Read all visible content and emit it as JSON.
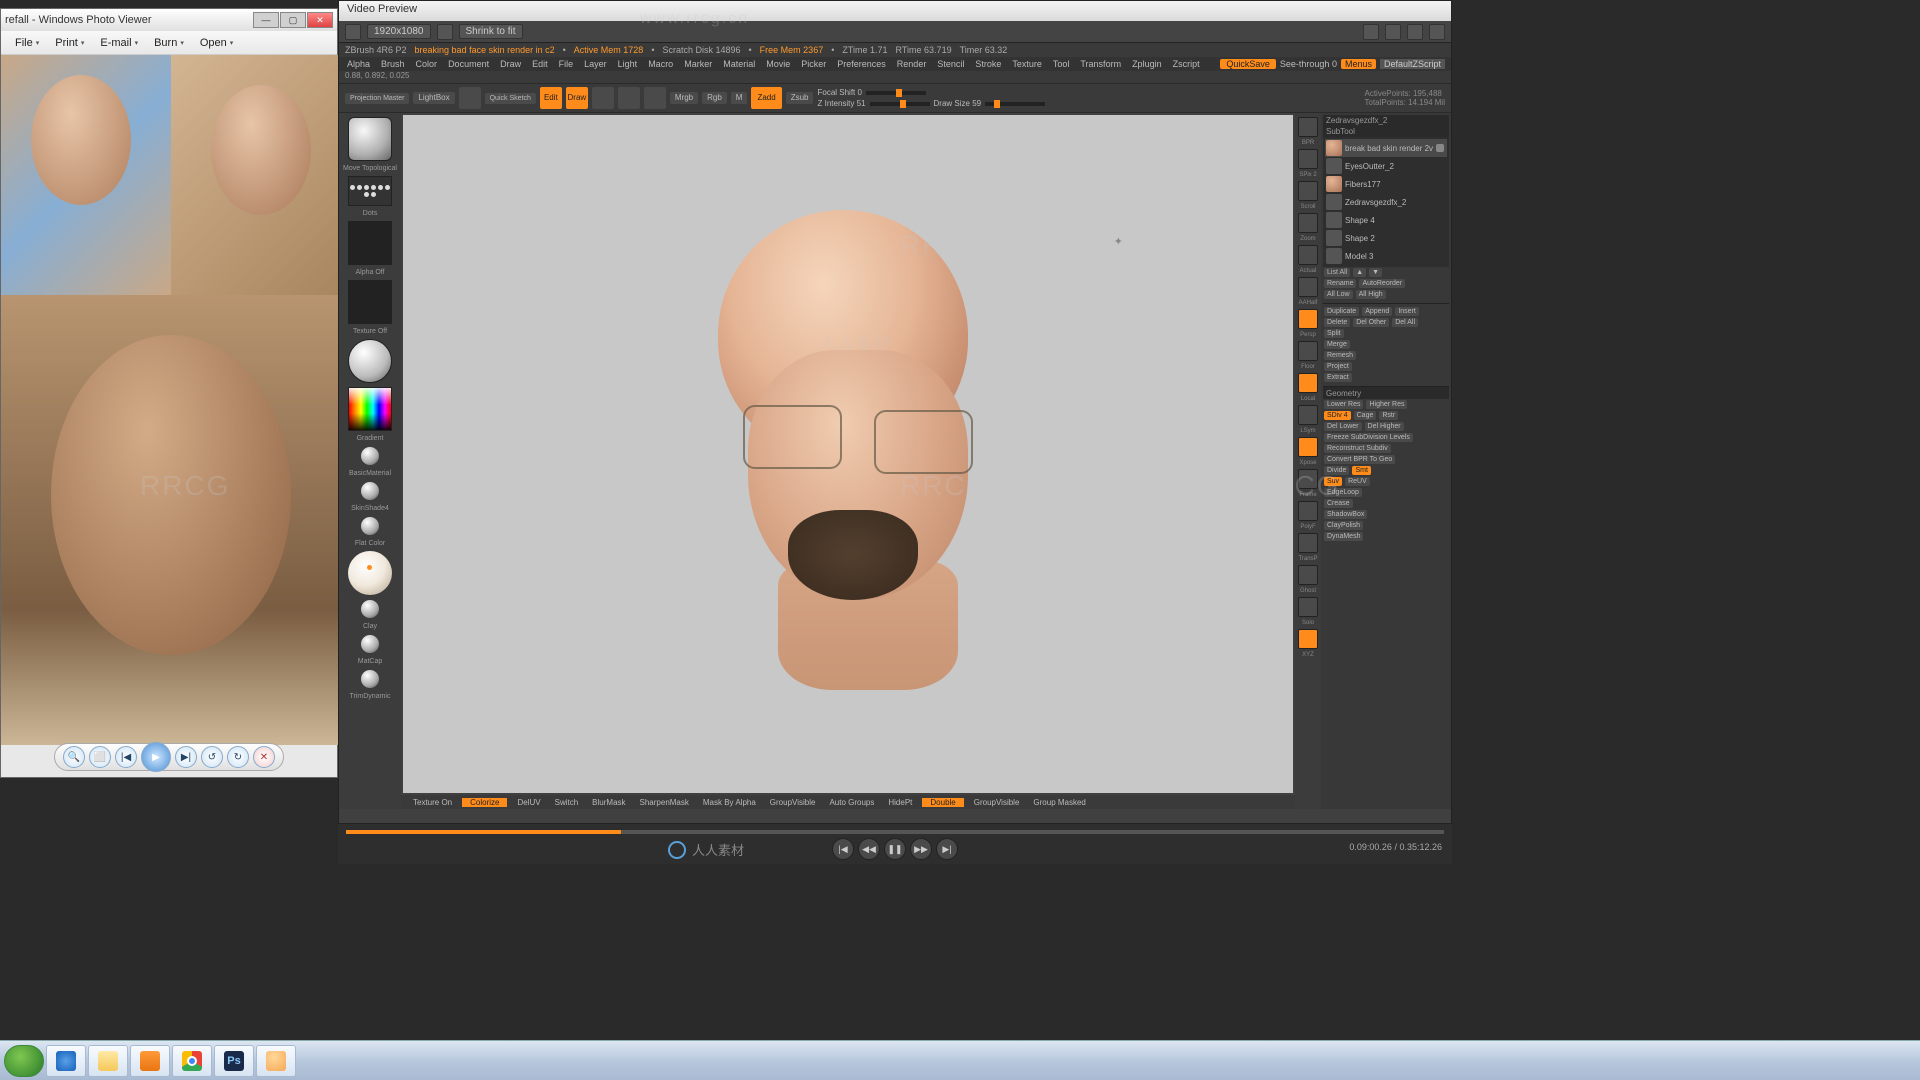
{
  "photoViewer": {
    "title": "refall - Windows Photo Viewer",
    "menu": [
      "File",
      "Print",
      "E-mail",
      "Burn",
      "Open"
    ],
    "controls": {
      "zoom": "🔍",
      "fit": "⬜",
      "prev": "|◀",
      "play": "▶",
      "next": "▶|",
      "rotL": "↺",
      "rotR": "↻",
      "del": "✕"
    }
  },
  "videoPreview": {
    "title": "Video Preview",
    "resolution": "1920x1080",
    "fit": "Shrink to fit"
  },
  "zbrush": {
    "topInfo": {
      "version": "ZBrush 4R6 P2",
      "project": "breaking bad face skin render in c2",
      "activeMem": "Active Mem 1728",
      "scratch": "Scratch Disk 14896",
      "freeMem": "Free Mem 2367",
      "ztime": "ZTime 1.71",
      "rtime": "RTime 63.719",
      "timer": "Timer 63.32"
    },
    "subInfo": "0.88, 0.892, 0.025",
    "menus": [
      "Alpha",
      "Brush",
      "Color",
      "Document",
      "Draw",
      "Edit",
      "File",
      "Layer",
      "Light",
      "Macro",
      "Marker",
      "Material",
      "Movie",
      "Picker",
      "Preferences",
      "Render",
      "Stencil",
      "Stroke",
      "Texture",
      "Tool",
      "Transform",
      "Zplugin",
      "Zscript"
    ],
    "menuRight": {
      "quickSave": "QuickSave",
      "seeThrough": "See-through 0",
      "menus": "Menus",
      "defaultScript": "DefaultZScript"
    },
    "shelf": {
      "projMaster": "Projection\nMaster",
      "lightBox": "LightBox",
      "quickSketch": "Quick\nSketch",
      "edit": "Edit",
      "draw": "Draw",
      "move": "Move",
      "scale": "Scale",
      "rotate": "Rotate",
      "mrgb": "Mrgb",
      "rgb": "Rgb",
      "m": "M",
      "zadd": "Zadd",
      "zsub": "Zsub",
      "focalShift": "Focal Shift 0",
      "zIntensity": "Z Intensity 51",
      "drawSize": "Draw Size 59",
      "activePoints": "ActivePoints: 195,488",
      "totalPoints": "TotalPoints: 14.194 Mil"
    },
    "leftBar": {
      "brush": "Move Topological",
      "stroke": "Dots",
      "alpha": "Alpha Off",
      "texture": "Texture Off",
      "gradient": "Gradient",
      "materials": [
        "BasicMaterial",
        "SkinShade4",
        "Flat Color",
        "Clay",
        "MatCap",
        "TrimDynamic"
      ]
    },
    "rightTools": [
      "BPR",
      "SPix 2",
      "Scroll",
      "Zoom",
      "Actual",
      "AAHalf",
      "Persp",
      "Floor",
      "Local",
      "LSym",
      "Xpose",
      "Frame",
      "PolyF",
      "TransP",
      "Ghost",
      "Solo",
      "XYZ"
    ],
    "bottomBar": {
      "textureOn": "Texture On",
      "colorize": "Colorize",
      "del": "DelUV",
      "switch": "Switch",
      "blurMask": "BlurMask",
      "sharpenMask": "SharpenMask",
      "maskByAlpha": "Mask By Alpha",
      "groupVisible": "GroupVisible",
      "autoGroups": "Auto Groups",
      "hidePt": "HidePt",
      "double": "Double",
      "groupVisible2": "GroupVisible",
      "groupMasked": "Group Masked"
    },
    "panel": {
      "toolName": "Zedravsgezdfx_2",
      "section": "SubTool",
      "subtools": [
        {
          "name": "break bad skin render 2v",
          "sel": true
        },
        {
          "name": "EyesOutter_2",
          "sel": false
        },
        {
          "name": "Fibers177",
          "sel": false
        },
        {
          "name": "Zedravsgezdfx_2",
          "sel": false
        },
        {
          "name": "Shape 4",
          "sel": false
        },
        {
          "name": "Shape 2",
          "sel": false
        },
        {
          "name": "Model 3",
          "sel": false
        }
      ],
      "listAll": "List All",
      "rename": "Rename",
      "autoReorder": "AutoReorder",
      "allLow": "All Low",
      "allHigh": "All High",
      "duplicate": "Duplicate",
      "append": "Append",
      "insert": "Insert",
      "delete": "Delete",
      "delOther": "Del Other",
      "delAll": "Del All",
      "split": "Split",
      "merge": "Merge",
      "remesh": "Remesh",
      "project": "Project",
      "extract": "Extract",
      "geometry": "Geometry",
      "lowerRes": "Lower Res",
      "higherRes": "Higher Res",
      "sdiv": "SDiv 4",
      "cage": "Cage",
      "rstr": "Rstr",
      "delLower": "Del Lower",
      "delHigher": "Del Higher",
      "freeze": "Freeze SubDivision Levels",
      "reconstruct": "Reconstruct Subdiv",
      "convertBPR": "Convert BPR To Geo",
      "divide": "Divide",
      "smt": "Smt",
      "suv": "Suv",
      "reuv": "ReUV",
      "edgeLoop": "EdgeLoop",
      "crease": "Crease",
      "shadowBox": "ShadowBox",
      "clayPolish": "ClayPolish",
      "dynaMesh": "DynaMesh"
    }
  },
  "playback": {
    "current": "0.09:00.26",
    "total": "0.35:12.26",
    "logoTxt": "人人素材"
  },
  "watermark": {
    "url": "www.rrcg.cn",
    "txt": "RRCG",
    "cn": "人人素材"
  }
}
